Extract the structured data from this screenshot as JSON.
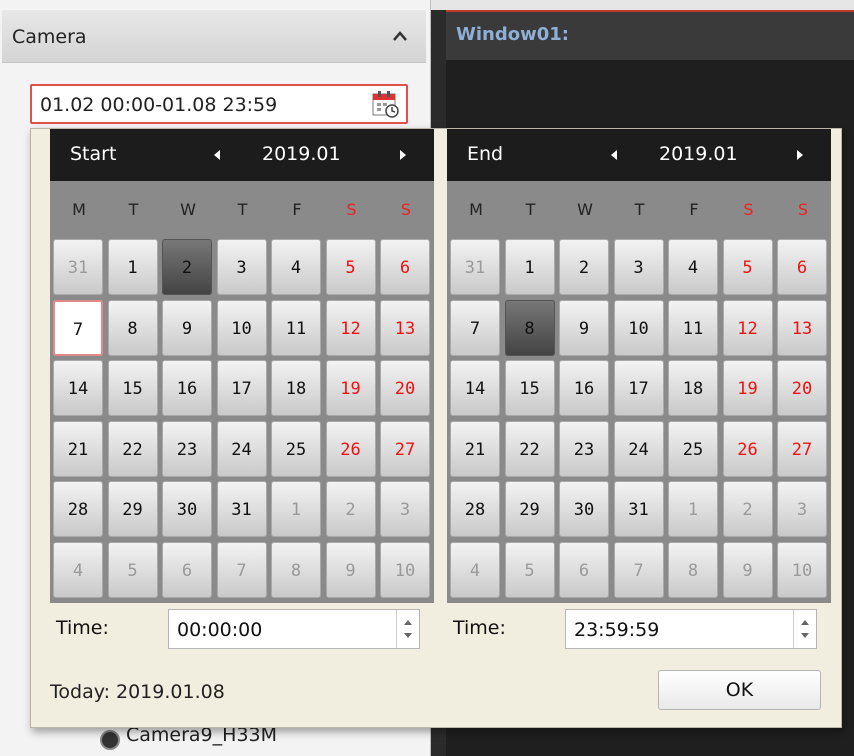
{
  "camera_panel": {
    "title": "Camera",
    "date_range": "01.02 00:00-01.08 23:59",
    "partial_item_label": "Camera9_H33M"
  },
  "window": {
    "title": "Window01:"
  },
  "picker": {
    "weekday_headers": [
      "M",
      "T",
      "W",
      "T",
      "F",
      "S",
      "S"
    ],
    "start": {
      "label": "Start",
      "month": "2019.01",
      "time_label": "Time:",
      "time_value": "00:00:00",
      "weeks": [
        [
          "31",
          "1",
          "2",
          "3",
          "4",
          "5",
          "6"
        ],
        [
          "7",
          "8",
          "9",
          "10",
          "11",
          "12",
          "13"
        ],
        [
          "14",
          "15",
          "16",
          "17",
          "18",
          "19",
          "20"
        ],
        [
          "21",
          "22",
          "23",
          "24",
          "25",
          "26",
          "27"
        ],
        [
          "28",
          "29",
          "30",
          "31",
          "1",
          "2",
          "3"
        ],
        [
          "4",
          "5",
          "6",
          "7",
          "8",
          "9",
          "10"
        ]
      ],
      "selected_day": "2"
    },
    "end": {
      "label": "End",
      "month": "2019.01",
      "time_label": "Time:",
      "time_value": "23:59:59",
      "weeks": [
        [
          "31",
          "1",
          "2",
          "3",
          "4",
          "5",
          "6"
        ],
        [
          "7",
          "8",
          "9",
          "10",
          "11",
          "12",
          "13"
        ],
        [
          "14",
          "15",
          "16",
          "17",
          "18",
          "19",
          "20"
        ],
        [
          "21",
          "22",
          "23",
          "24",
          "25",
          "26",
          "27"
        ],
        [
          "28",
          "29",
          "30",
          "31",
          "1",
          "2",
          "3"
        ],
        [
          "4",
          "5",
          "6",
          "7",
          "8",
          "9",
          "10"
        ]
      ],
      "selected_day": "8"
    },
    "today_text": "Today: 2019.01.08",
    "ok_label": "OK"
  },
  "colors": {
    "weekend": "#ee1111",
    "header_bg": "#1c1c1c",
    "focus_border": "#e0504d"
  },
  "icons": [
    "collapse-up-icon",
    "calendar-icon",
    "prev-month-icon",
    "next-month-icon",
    "spin-up-icon",
    "spin-down-icon",
    "camera-icon"
  ]
}
